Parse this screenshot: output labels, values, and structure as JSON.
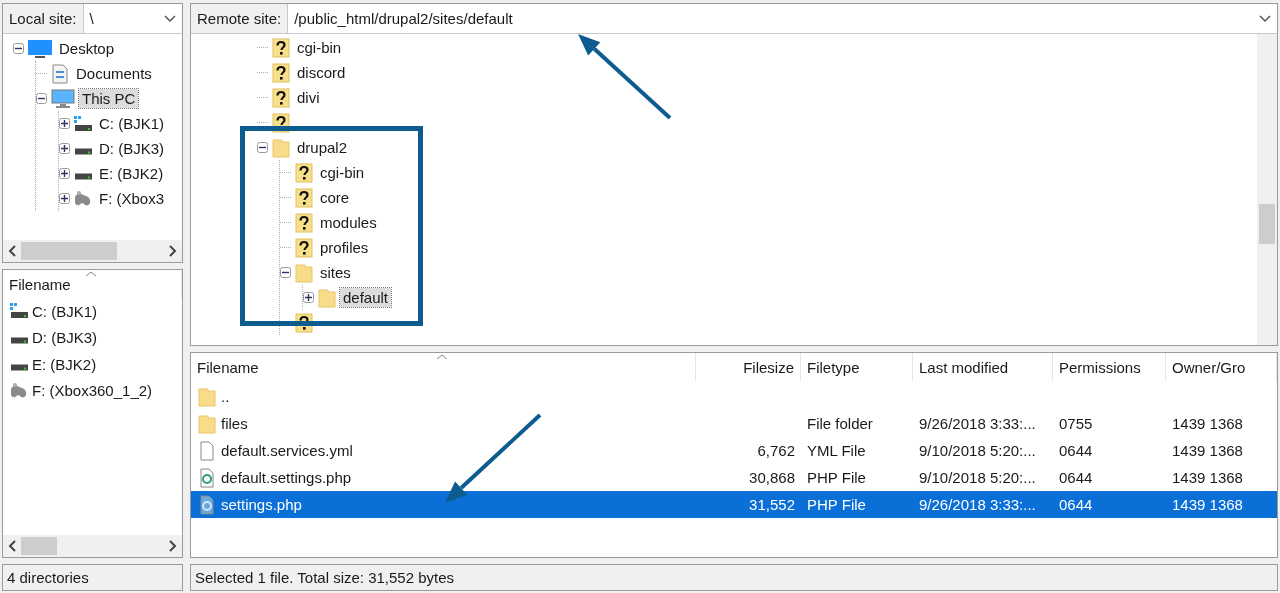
{
  "local": {
    "site_label": "Local site:",
    "path": "\\",
    "tree": [
      {
        "label": "Desktop",
        "kind": "desktop",
        "expanded": true,
        "selected": false,
        "children": [
          {
            "label": "Documents",
            "kind": "documents",
            "selected": false
          },
          {
            "label": "This PC",
            "kind": "pc",
            "expanded": true,
            "selected": true,
            "children": [
              {
                "label": "C: (BJK1)",
                "kind": "system-drive",
                "expanded": false,
                "selected": false
              },
              {
                "label": "D: (BJK3)",
                "kind": "drive",
                "expanded": false,
                "selected": false
              },
              {
                "label": "E: (BJK2)",
                "kind": "drive",
                "expanded": false,
                "selected": false
              },
              {
                "label": "F: (Xbox3",
                "kind": "controller",
                "expanded": false,
                "selected": false
              }
            ]
          }
        ]
      }
    ],
    "list": {
      "columns": [
        "Filename"
      ],
      "rows": [
        {
          "name": "C: (BJK1)",
          "kind": "system-drive"
        },
        {
          "name": "D: (BJK3)",
          "kind": "drive"
        },
        {
          "name": "E: (BJK2)",
          "kind": "drive"
        },
        {
          "name": "F: (Xbox360_1_2)",
          "kind": "controller"
        }
      ]
    },
    "status": "4 directories"
  },
  "remote": {
    "site_label": "Remote site:",
    "path": "/public_html/drupal2/sites/default",
    "tree": [
      {
        "label": "cgi-bin",
        "kind": "unknown",
        "selected": false
      },
      {
        "label": "discord",
        "kind": "unknown",
        "selected": false
      },
      {
        "label": "divi",
        "kind": "unknown",
        "selected": false
      },
      {
        "kind": "unknown",
        "selected": false
      },
      {
        "label": "drupal2",
        "kind": "folder",
        "expanded": true,
        "selected": false,
        "children": [
          {
            "label": "cgi-bin",
            "kind": "unknown",
            "selected": false
          },
          {
            "label": "core",
            "kind": "unknown",
            "selected": false
          },
          {
            "label": "modules",
            "kind": "unknown",
            "selected": false
          },
          {
            "label": "profiles",
            "kind": "unknown",
            "selected": false
          },
          {
            "label": "sites",
            "kind": "folder",
            "expanded": true,
            "selected": false,
            "children": [
              {
                "label": "default",
                "kind": "folder",
                "expanded": false,
                "selected": true
              }
            ]
          },
          {
            "kind": "unknown",
            "selected": false
          }
        ]
      }
    ],
    "list": {
      "columns": [
        "Filename",
        "Filesize",
        "Filetype",
        "Last modified",
        "Permissions",
        "Owner/Gro"
      ],
      "rows": [
        {
          "kind": "folder",
          "selected": false,
          "cells": [
            "..",
            "",
            "",
            "",
            "",
            ""
          ]
        },
        {
          "kind": "folder",
          "selected": false,
          "cells": [
            "files",
            "",
            "File folder",
            "9/26/2018 3:33:...",
            "0755",
            "1439 1368"
          ]
        },
        {
          "kind": "file",
          "selected": false,
          "cells": [
            "default.services.yml",
            "6,762",
            "YML File",
            "9/10/2018 5:20:...",
            "0644",
            "1439 1368"
          ]
        },
        {
          "kind": "php",
          "selected": false,
          "cells": [
            "default.settings.php",
            "30,868",
            "PHP File",
            "9/10/2018 5:20:...",
            "0644",
            "1439 1368"
          ]
        },
        {
          "kind": "php",
          "selected": true,
          "cells": [
            "settings.php",
            "31,552",
            "PHP File",
            "9/26/2018 3:33:...",
            "0644",
            "1439 1368"
          ]
        }
      ]
    },
    "status": "Selected 1 file. Total size: 31,552 bytes"
  },
  "annotations": [
    {
      "kind": "arrow"
    },
    {
      "kind": "box"
    },
    {
      "kind": "arrow"
    }
  ]
}
